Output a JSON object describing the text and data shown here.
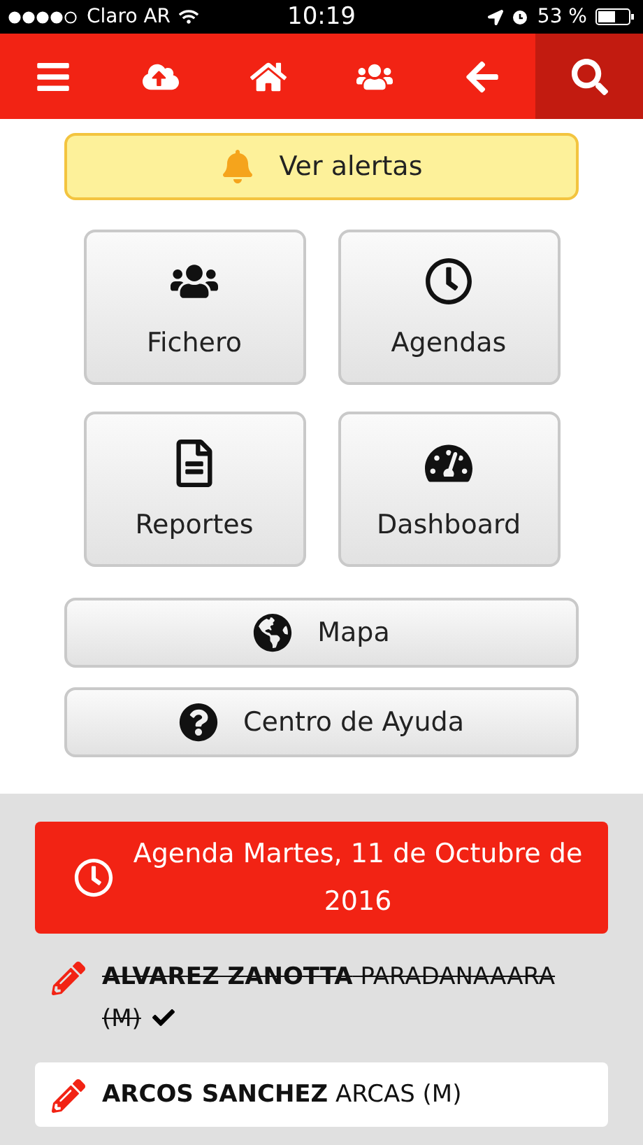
{
  "status_bar": {
    "carrier": "Claro AR",
    "time": "10:19",
    "battery": "53 %"
  },
  "nav": [
    {
      "kind": "menu",
      "selected": false
    },
    {
      "kind": "upload",
      "selected": false
    },
    {
      "kind": "home",
      "selected": false
    },
    {
      "kind": "users",
      "selected": false
    },
    {
      "kind": "back",
      "selected": false
    },
    {
      "kind": "search",
      "selected": true
    }
  ],
  "alert_button": {
    "label": "Ver alertas"
  },
  "tiles": [
    {
      "kind": "users",
      "label": "Fichero"
    },
    {
      "kind": "clock",
      "label": "Agendas"
    },
    {
      "kind": "file",
      "label": "Reportes"
    },
    {
      "kind": "gauge",
      "label": "Dashboard"
    }
  ],
  "wide_buttons": [
    {
      "kind": "globe",
      "label": "Mapa"
    },
    {
      "kind": "help",
      "label": "Centro de Ayuda"
    }
  ],
  "agenda": {
    "title": "Agenda Martes, 11 de Octubre de 2016",
    "patients": [
      {
        "name": "**ALVAREZ ZANOTTA** PARADANAAARA (M)",
        "done": true
      },
      {
        "name": "**ARCOS SANCHEZ** ARCAS (M)",
        "done": false
      }
    ]
  }
}
